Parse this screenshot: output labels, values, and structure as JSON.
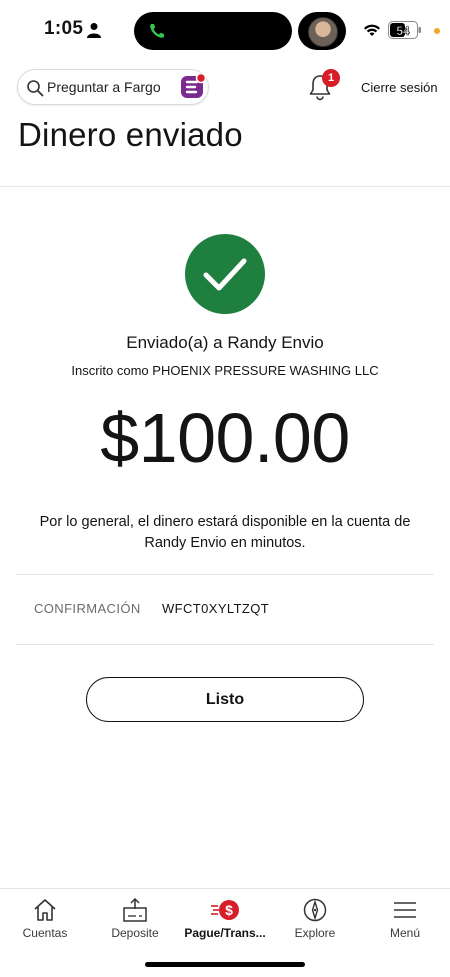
{
  "status_bar": {
    "time": "1:05",
    "battery": "54"
  },
  "header": {
    "search_placeholder": "Preguntar a Fargo",
    "notification_count": "1",
    "logout_label": "Cierre sesión"
  },
  "page": {
    "title": "Dinero enviado"
  },
  "confirmation": {
    "sent_to": "Enviado(a) a Randy Envio",
    "enrolled_as": "Inscrito como PHOENIX PRESSURE WASHING LLC",
    "amount": "$100.00",
    "notice": "Por lo general, el dinero estará disponible en la cuenta de Randy Envio en minutos.",
    "confirmation_label": "CONFIRMACIÓN",
    "confirmation_code": "WFCT0XYLTZQT",
    "done_label": "Listo"
  },
  "colors": {
    "success": "#1e7f3e",
    "brand_red": "#d71e28",
    "brand_purple": "#7b2b8f"
  },
  "bottom_nav": [
    {
      "label": "Cuentas",
      "icon": "home-icon",
      "active": false
    },
    {
      "label": "Deposite",
      "icon": "deposit-icon",
      "active": false
    },
    {
      "label": "Pague/Trans...",
      "icon": "pay-transfer-icon",
      "active": true
    },
    {
      "label": "Explore",
      "icon": "compass-icon",
      "active": false
    },
    {
      "label": "Menú",
      "icon": "menu-icon",
      "active": false
    }
  ]
}
